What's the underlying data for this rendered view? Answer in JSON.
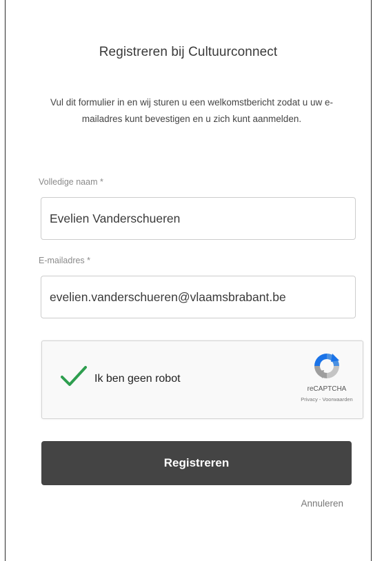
{
  "form": {
    "title": "Registreren bij Cultuurconnect",
    "intro": "Vul dit formulier in en wij sturen u een welkomstbericht zodat u uw e-mailadres kunt bevestigen en u zich kunt aanmelden.",
    "full_name": {
      "label": "Volledige naam *",
      "value": "Evelien Vanderschueren"
    },
    "email": {
      "label": "E-mailadres *",
      "value": "evelien.vanderschueren@vlaamsbrabant.be"
    },
    "recaptcha": {
      "label": "Ik ben geen robot",
      "checked": true,
      "brand": "reCAPTCHA",
      "terms": "Privacy - Voorwaarden",
      "check_color": "#2e9e4f"
    },
    "submit_label": "Registreren",
    "cancel_label": "Annuleren"
  }
}
